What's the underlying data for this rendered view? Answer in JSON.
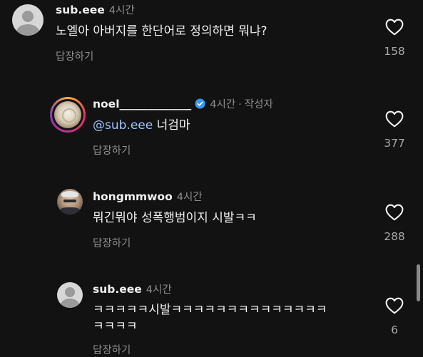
{
  "comments": [
    {
      "username": "sub.eee",
      "time": "4시간",
      "text": "노엘아 아버지를 한단어로 정의하면 뭐냐?",
      "reply_label": "답장하기",
      "likes": "158"
    },
    {
      "username": "noel_____________",
      "time": "4시간",
      "author_tag": "작성자",
      "mention": "@sub.eee",
      "text": "너검마",
      "reply_label": "답장하기",
      "likes": "377"
    },
    {
      "username": "hongmmwoo",
      "time": "4시간",
      "text": "뭐긴뭐야 성폭행범이지 시발ㅋㅋ",
      "reply_label": "답장하기",
      "likes": "288"
    },
    {
      "username": "sub.eee",
      "time": "4시간",
      "text_line1": "ㅋㅋㅋㅋㅋ시발ㅋㅋㅋㅋㅋㅋㅋㅋㅋㅋㅋㅋㅋㅋ",
      "text_line2": "ㅋㅋㅋㅋ",
      "reply_label": "답장하기",
      "likes": "6"
    }
  ],
  "colors": {
    "background": "#121212",
    "mention": "#9bc3ff",
    "verified": "#3897f0",
    "secondary_text": "#8e8e8e"
  },
  "icons": [
    "heart-outline-icon",
    "verified-badge-icon",
    "default-avatar-icon"
  ]
}
